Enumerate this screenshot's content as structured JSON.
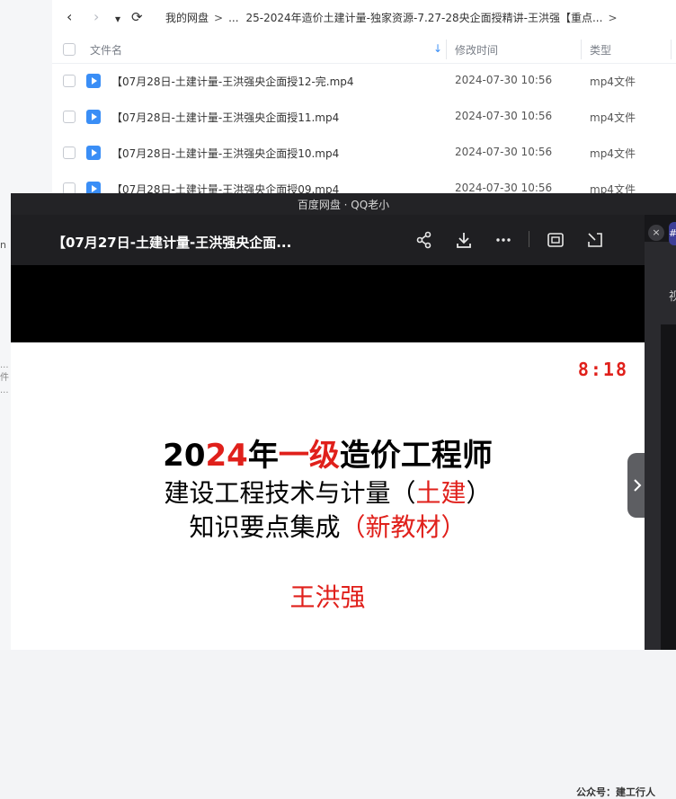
{
  "left_sliver": {
    "fragment": "n",
    "dots": [
      "...",
      "件",
      "..."
    ]
  },
  "file_manager": {
    "nav": {
      "back": "‹",
      "forward": "›",
      "dropdown": "▾",
      "refresh": "⟳"
    },
    "breadcrumb": {
      "root": "我的网盘",
      "ellipsis": "...",
      "current": "25-2024年造价土建计量-独家资源-7.27-28央企面授精讲-王洪强【重点...",
      "separator": ">"
    },
    "columns": {
      "name": "文件名",
      "sort_indicator": "↓",
      "modified": "修改时间",
      "type": "类型"
    },
    "files": [
      {
        "name": "【07月28日-土建计量-王洪强央企面授12-完.mp4",
        "date": "2024-07-30 10:56",
        "type": "mp4文件"
      },
      {
        "name": "【07月28日-土建计量-王洪强央企面授11.mp4",
        "date": "2024-07-30 10:56",
        "type": "mp4文件"
      },
      {
        "name": "【07月28日-土建计量-王洪强央企面授10.mp4",
        "date": "2024-07-30 10:56",
        "type": "mp4文件"
      },
      {
        "name": "【07月28日-土建计量-王洪强央企面授09.mp4",
        "date": "2024-07-30 10:56",
        "type": "mp4文件"
      }
    ]
  },
  "player": {
    "source": "百度网盘 · QQ老小",
    "title": "【07月27日-土建计量-王洪强央企面...",
    "icons": {
      "share": "share-icon",
      "download": "download-icon",
      "more": "more-icon",
      "screenshot": "screenshot-icon",
      "pip": "pip-icon",
      "next": "next-icon"
    },
    "side": {
      "close": "×",
      "tag": "#",
      "label": "视"
    },
    "slide": {
      "timer": "8:18",
      "line1": {
        "a": "20",
        "b": "24",
        "c": "年",
        "d": "一级",
        "e": "造价工程师"
      },
      "line2": {
        "a": "建设工程技术与计量（",
        "b": "土建",
        "c": "）"
      },
      "line3": {
        "a": "知识要点集成",
        "b": "（新教材）"
      },
      "author": "王洪强",
      "watermark": "公众号：建工行人"
    }
  },
  "colors": {
    "accent": "#3a8ef6",
    "red": "#e0201b",
    "player_bg": "#1f1f22"
  }
}
